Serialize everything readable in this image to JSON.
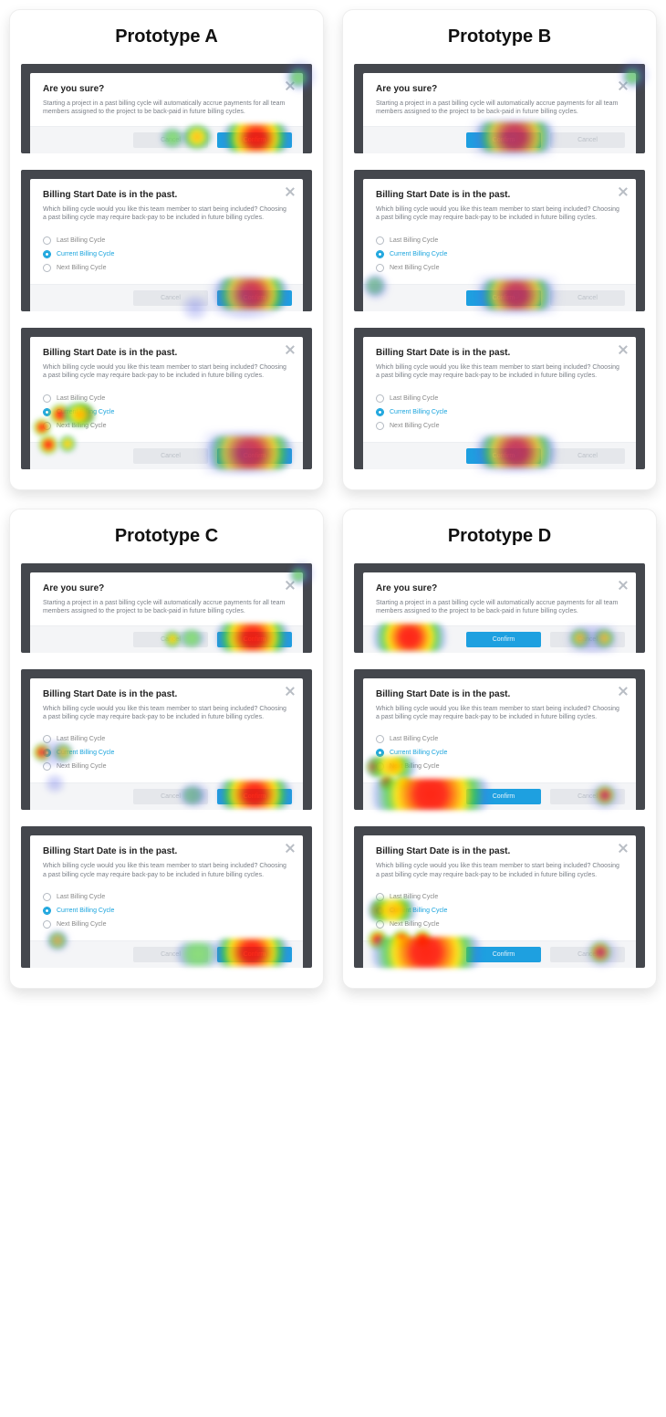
{
  "titles": {
    "a": "Prototype A",
    "b": "Prototype B",
    "c": "Prototype C",
    "d": "Prototype D"
  },
  "dlg1": {
    "h": "Are you sure?",
    "p": "Starting a project in a past billing cycle will automatically accrue payments for all team members assigned to the project  to be back-paid in future billing cycles."
  },
  "dlg2": {
    "h": "Billing Start Date is in the past.",
    "p": "Which billing cycle would you like this team member to start being included? Choosing a past billing cycle may require back-pay to be included in future billing cycles."
  },
  "options": {
    "o1": "Last Billing Cycle",
    "o2": "Current Billing Cycle",
    "o3": "Next Billing Cycle"
  },
  "btn": {
    "cancel": "Cancel",
    "confirm": "Confirm"
  }
}
